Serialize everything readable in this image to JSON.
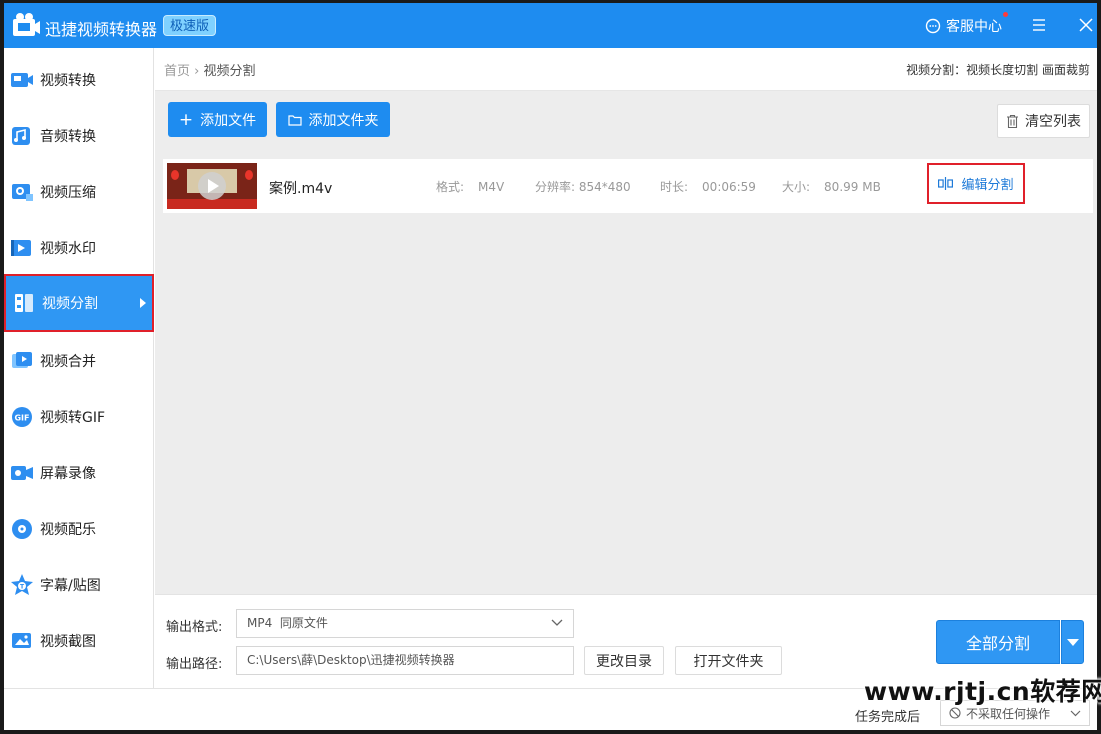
{
  "app": {
    "title": "迅捷视频转换器",
    "edition": "极速版",
    "support_label": "客服中心"
  },
  "sidebar": {
    "items": [
      {
        "label": "视频转换",
        "icon": "video-convert-icon"
      },
      {
        "label": "音频转换",
        "icon": "audio-convert-icon"
      },
      {
        "label": "视频压缩",
        "icon": "video-compress-icon"
      },
      {
        "label": "视频水印",
        "icon": "video-watermark-icon"
      },
      {
        "label": "视频分割",
        "icon": "video-split-icon",
        "active": true
      },
      {
        "label": "视频合并",
        "icon": "video-merge-icon"
      },
      {
        "label": "视频转GIF",
        "icon": "gif-icon"
      },
      {
        "label": "屏幕录像",
        "icon": "screen-record-icon"
      },
      {
        "label": "视频配乐",
        "icon": "music-icon"
      },
      {
        "label": "字幕/贴图",
        "icon": "subtitle-icon"
      },
      {
        "label": "视频截图",
        "icon": "screenshot-icon"
      }
    ]
  },
  "breadcrumb": {
    "home": "首页",
    "current": "视频分割",
    "tip": "视频分割：视频长度切割 画面裁剪"
  },
  "toolbar": {
    "add_file": "添加文件",
    "add_folder": "添加文件夹",
    "clear_list": "清空列表"
  },
  "file": {
    "name": "案例.m4v",
    "format_label": "格式:",
    "format": "M4V",
    "resolution_label": "分辨率:",
    "resolution": "854*480",
    "duration_label": "时长:",
    "duration": "00:06:59",
    "size_label": "大小:",
    "size": "80.99 MB",
    "edit_split": "编辑分割"
  },
  "output": {
    "format_label": "输出格式:",
    "format_value": "MP4  同原文件",
    "path_label": "输出路径:",
    "path_value": "C:\\Users\\薛\\Desktop\\迅捷视频转换器",
    "change_dir": "更改目录",
    "open_folder": "打开文件夹",
    "split_all": "全部分割"
  },
  "status": {
    "after_label": "任务完成后",
    "after_value": "不采取任何操作"
  },
  "watermark": "www.rjtj.cn软荐网",
  "colors": {
    "brand": "#1e8cf0",
    "active_border": "#e0202a"
  }
}
